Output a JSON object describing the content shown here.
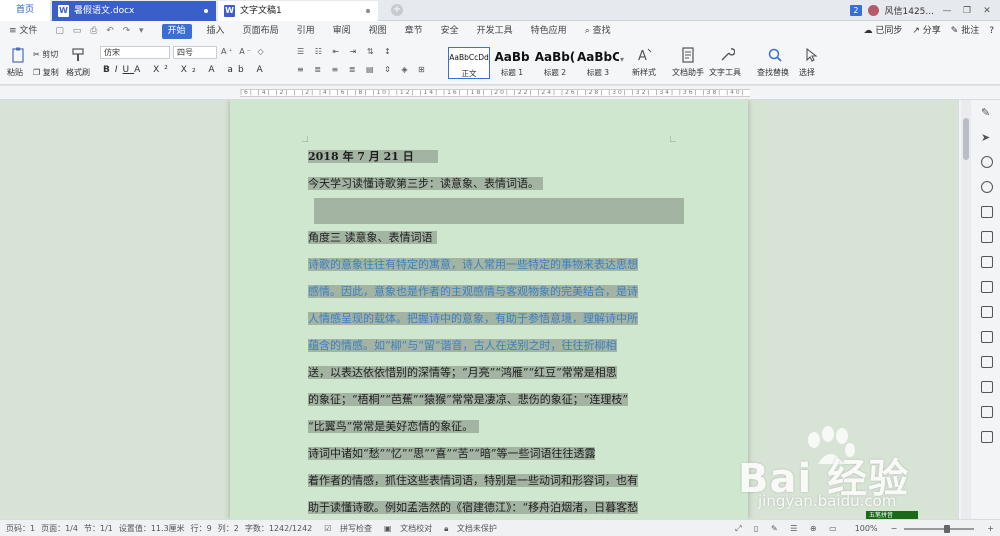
{
  "tabs": {
    "home": "首页",
    "doc1": "暑假语文.docx",
    "doc2": "文字文稿1",
    "plus": "+",
    "badge": "2",
    "user": "风信1425...",
    "win_min": "—",
    "win_max": "❐",
    "win_close": "✕"
  },
  "menu": {
    "file": "≡ 文件",
    "items": [
      "开始",
      "插入",
      "页面布局",
      "引用",
      "审阅",
      "视图",
      "章节",
      "安全",
      "开发工具",
      "特色应用"
    ],
    "search": "查找",
    "sync": "已同步",
    "share": "分享",
    "comment": "批注",
    "help": "?"
  },
  "ribbon": {
    "paste": "粘贴",
    "cut": "剪切",
    "copy": "复制",
    "format_painter": "格式刷",
    "font_name": "仿宋",
    "font_size": "四号",
    "styles": [
      {
        "preview": "AaBbCcDd",
        "label": "正文"
      },
      {
        "preview": "AaBb",
        "label": "标题 1"
      },
      {
        "preview": "AaBb(",
        "label": "标题 2"
      },
      {
        "preview": "AaBbC",
        "label": "标题 3"
      }
    ],
    "new_style": "新样式",
    "writer_helper": "文档助手",
    "text_tools": "文字工具",
    "find_replace": "查找替换",
    "select": "选择"
  },
  "ruler": {
    "scale": "|6| |4| |2| | |2| |4| |6| |8| |10| |12| |14| |16| |18| |20| |22| |24| |26| |28| |30| |32| |34| |36| |38| |40| |42| |44| |46|"
  },
  "document": {
    "lines": [
      "2018 年 7 月 21 日",
      "今天学习读懂诗歌第三步：读意象、表情词语。",
      "",
      "角度三   读意象、表情词语",
      "诗歌的意象往往有特定的寓意，诗人常用一些特定的事物来表达思想",
      "感情。因此，意象也是作者的主观感情与客观物象的完美结合，是诗",
      "人情感呈现的载体。把握诗中的意象，有助于参悟意境，理解诗中所",
      "蕴含的情感。如“柳”与“留”谐音，古人在送别之时，往往折柳相",
      "送，以表达依依惜别的深情等；“月亮”“鸿雁”“红豆”常常是相思",
      "的象征；“梧桐”“芭蕉”“猿猴”常常是凄凉、悲伤的象征；“连理枝”",
      "“比翼鸟”常常是美好恋情的象征。",
      "诗词中诸如“愁”“忆”“思”“喜”“苦”“暗”等一些词语往往透露",
      "着作者的情感，抓住这些表情词语，特别是一些动词和形容词，也有",
      "助于读懂诗歌。例如孟浩然的《宿建德江》：“移舟泊烟渚，日暮客愁"
    ]
  },
  "status": {
    "page_num": "页码：1",
    "pages": "页面：1/4",
    "section": "节：1/1",
    "setting": "设置值：11.3厘米",
    "row": "行：9",
    "col": "列：2",
    "words": "字数：1242/1242",
    "spell": "拼写检查",
    "proof": "文档校对",
    "unprotected": "文档未保护",
    "zoom": "100%",
    "ime": "五笔拼音"
  },
  "watermark": {
    "brand": "Bai 经验",
    "url": "jingyan.baidu.com"
  },
  "colors": {
    "accent": "#3b6fd6",
    "highlight": "#a3b4a3",
    "blue_text": "#3b7fc4",
    "page_bg": "#cfe7cf"
  }
}
